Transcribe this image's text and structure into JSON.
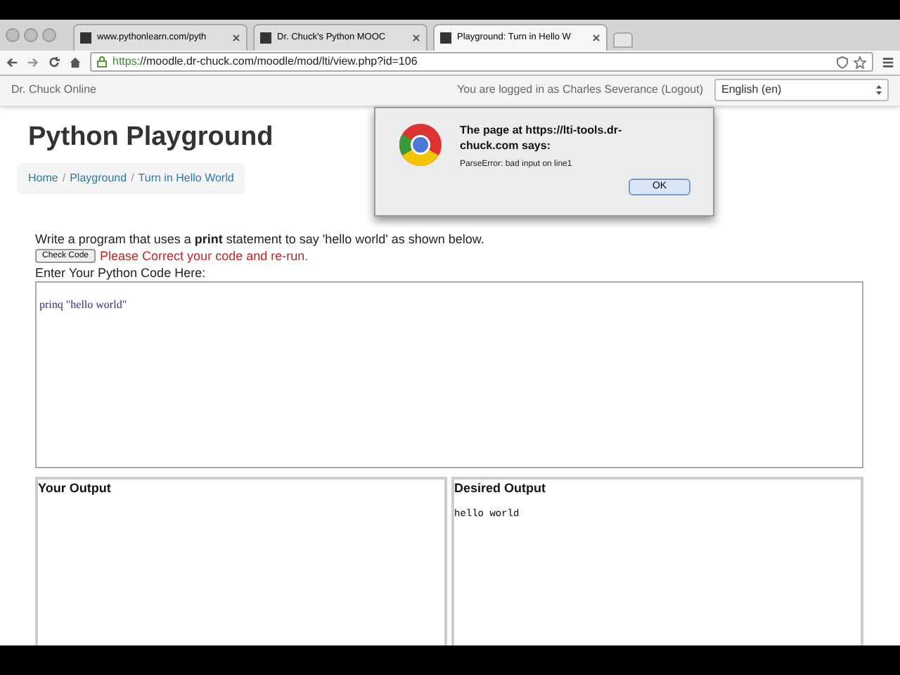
{
  "browser": {
    "tabs": [
      {
        "title": "www.pythonlearn.com/pyth",
        "selected": false
      },
      {
        "title": "Dr. Chuck's Python MOOC",
        "selected": false
      },
      {
        "title": "Playground: Turn in Hello W",
        "selected": true
      }
    ],
    "url": {
      "scheme": "https",
      "rest": "://moodle.dr-chuck.com/moodle/mod/lti/view.php?id=106"
    }
  },
  "site_header": {
    "site_name": "Dr. Chuck Online",
    "login_text": "You are logged in as Charles Severance (Logout)",
    "language": "English (en)"
  },
  "page": {
    "title": "Python Playground",
    "breadcrumb": {
      "separator": "/",
      "items": [
        "Home",
        "Playground",
        "Turn in Hello World"
      ]
    },
    "instructions": "Write a program that uses a **print** statement to say 'hello world' as shown below.",
    "check_button": "Check Code",
    "error": "Please Correct your code and re-run.",
    "code_label": "Enter Your Python Code Here:",
    "code": "prinq \"hello world\"",
    "outputs": [
      {
        "title": "Your Output"
      },
      {
        "title": "Desired Output",
        "text": "hello world"
      }
    ]
  },
  "dialog": {
    "title": "The page at https://lti-tools.dr-chuck.com says:",
    "message": "ParseError: bad input on line1",
    "button": "OK"
  }
}
